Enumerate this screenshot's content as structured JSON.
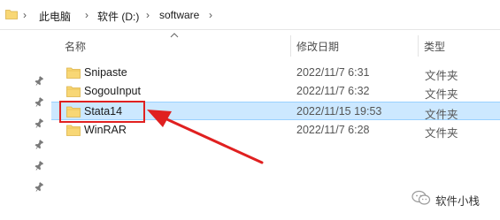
{
  "address_bar": {
    "crumbs": [
      "此电脑",
      "软件 (D:)",
      "software"
    ]
  },
  "columns": {
    "name": "名称",
    "date_modified": "修改日期",
    "type": "类型"
  },
  "files": [
    {
      "name": "Snipaste",
      "date": "2022/11/7 6:31",
      "type": "文件夹",
      "selected": false
    },
    {
      "name": "SogouInput",
      "date": "2022/11/7 6:32",
      "type": "文件夹",
      "selected": false
    },
    {
      "name": "Stata14",
      "date": "2022/11/15 19:53",
      "type": "文件夹",
      "selected": true
    },
    {
      "name": "WinRAR",
      "date": "2022/11/7 6:28",
      "type": "文件夹",
      "selected": false
    }
  ],
  "watermark": {
    "text": "软件小栈"
  },
  "colors": {
    "selection_bg": "#cce8ff",
    "selection_border": "#99d1ff",
    "annotation_red": "#e02020",
    "folder_yellow": "#f8d775"
  },
  "icons": {
    "folder": "folder-icon",
    "pin": "pin-icon",
    "chevron": "chevron-right-icon",
    "sort": "sort-ascending-icon"
  }
}
